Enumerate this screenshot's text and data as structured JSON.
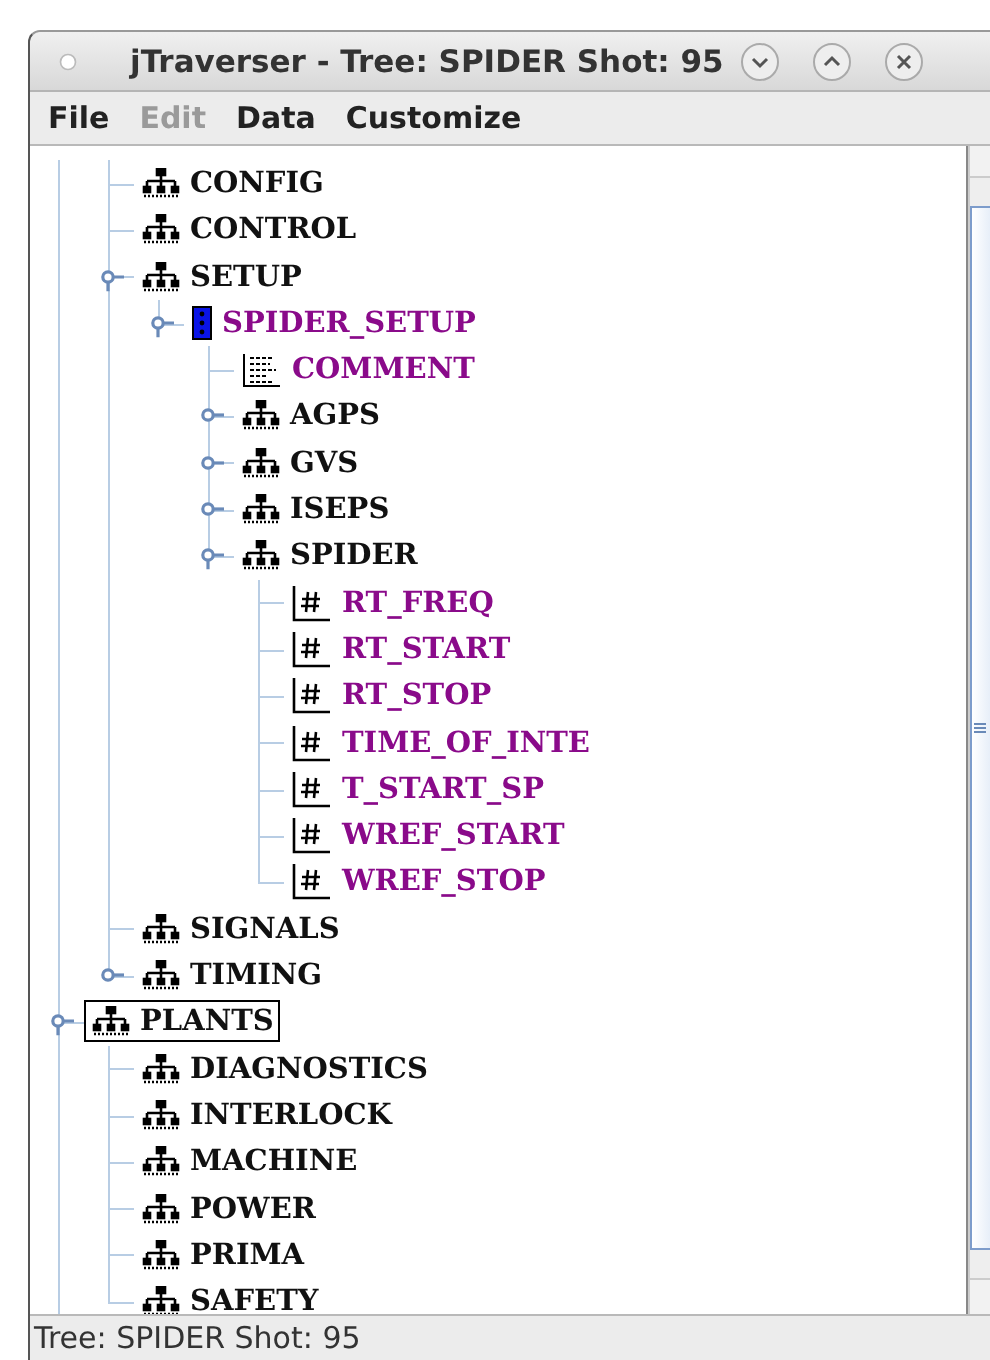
{
  "window": {
    "title": "jTraverser - Tree: SPIDER Shot: 95"
  },
  "menu": [
    {
      "label": "File",
      "disabled": false
    },
    {
      "label": "Edit",
      "disabled": true
    },
    {
      "label": "Data",
      "disabled": false
    },
    {
      "label": "Customize",
      "disabled": false
    }
  ],
  "tree": [
    {
      "children": [
        {
          "label": "CONFIG",
          "kind": "structure",
          "selected": false
        },
        {
          "label": "CONTROL",
          "kind": "structure",
          "selected": false
        },
        {
          "label": "SETUP",
          "kind": "structure",
          "selected": false,
          "expanded": true,
          "children": [
            {
              "label": "SPIDER_SETUP",
              "kind": "device",
              "selected": false,
              "expanded": true,
              "children": [
                {
                  "label": "COMMENT",
                  "kind": "text",
                  "selected": false
                },
                {
                  "label": "AGPS",
                  "kind": "structure",
                  "selected": false,
                  "expanded": false
                },
                {
                  "label": "GVS",
                  "kind": "structure",
                  "selected": false,
                  "expanded": false
                },
                {
                  "label": "ISEPS",
                  "kind": "structure",
                  "selected": false,
                  "expanded": false
                },
                {
                  "label": "SPIDER",
                  "kind": "structure",
                  "selected": false,
                  "expanded": true,
                  "children": [
                    {
                      "label": "RT_FREQ",
                      "kind": "numeric",
                      "selected": false
                    },
                    {
                      "label": "RT_START",
                      "kind": "numeric",
                      "selected": false
                    },
                    {
                      "label": "RT_STOP",
                      "kind": "numeric",
                      "selected": false
                    },
                    {
                      "label": "TIME_OF_INTE",
                      "kind": "numeric",
                      "selected": false
                    },
                    {
                      "label": "T_START_SP",
                      "kind": "numeric",
                      "selected": false
                    },
                    {
                      "label": "WREF_START",
                      "kind": "numeric",
                      "selected": false
                    },
                    {
                      "label": "WREF_STOP",
                      "kind": "numeric",
                      "selected": false
                    }
                  ]
                }
              ]
            }
          ]
        },
        {
          "label": "SIGNALS",
          "kind": "structure",
          "selected": false
        },
        {
          "label": "TIMING",
          "kind": "structure",
          "selected": false,
          "expanded": false
        }
      ]
    },
    {
      "label": "PLANTS",
      "kind": "structure",
      "selected": true,
      "expanded": true,
      "children": [
        {
          "label": "DIAGNOSTICS",
          "kind": "structure",
          "selected": false
        },
        {
          "label": "INTERLOCK",
          "kind": "structure",
          "selected": false
        },
        {
          "label": "MACHINE",
          "kind": "structure",
          "selected": false
        },
        {
          "label": "POWER",
          "kind": "structure",
          "selected": false
        },
        {
          "label": "PRIMA",
          "kind": "structure",
          "selected": false
        },
        {
          "label": "SAFETY",
          "kind": "structure",
          "selected": false
        }
      ]
    }
  ],
  "status_bar": "Tree: SPIDER Shot: 95"
}
